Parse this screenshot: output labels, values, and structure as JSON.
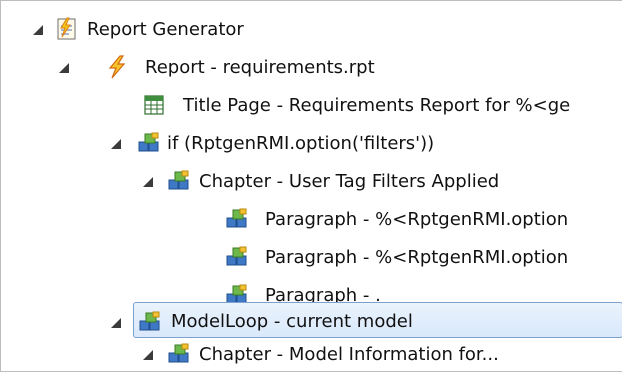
{
  "tree": {
    "nodes": [
      {
        "label": "Report Generator",
        "icon": "report-generator-icon"
      },
      {
        "label": "Report - requirements.rpt",
        "icon": "report-lightning-icon"
      },
      {
        "label": "Title Page - Requirements Report for %<ge",
        "icon": "title-page-icon"
      },
      {
        "label": "if (RptgenRMI.option('filters'))",
        "icon": "component-blocks-icon"
      },
      {
        "label": "Chapter - User Tag Filters Applied",
        "icon": "component-blocks-icon"
      },
      {
        "label": "Paragraph - %<RptgenRMI.option",
        "icon": "component-blocks-icon"
      },
      {
        "label": "Paragraph - %<RptgenRMI.option",
        "icon": "component-blocks-icon"
      },
      {
        "label": "Paragraph -  .",
        "icon": "component-blocks-icon"
      },
      {
        "label": "ModelLoop - current model",
        "icon": "component-blocks-icon",
        "selected": true
      },
      {
        "label": "Chapter - Model Information for...",
        "icon": "component-blocks-icon"
      }
    ]
  },
  "colors": {
    "selection_border": "#7da2ce",
    "selection_fill": "#dce9fb",
    "expander": "#3b3b3b"
  }
}
